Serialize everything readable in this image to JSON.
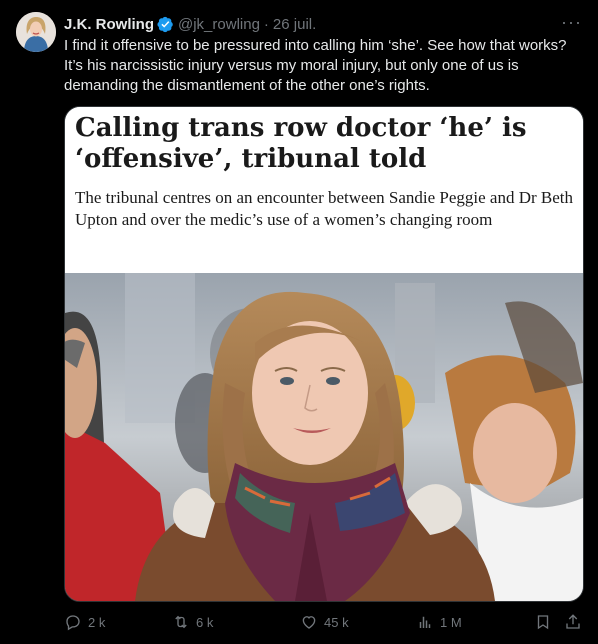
{
  "tweet": {
    "author_name": "J.K. Rowling",
    "handle": "@jk_rowling",
    "date": "26 juil.",
    "text": "I find it offensive to be pressured into calling him ‘she’. See how that works? It’s his narcissistic injury versus my moral injury, but only one of us is demanding the dismantlement of the other one’s rights."
  },
  "article": {
    "headline": "Calling trans row doctor ‘he’ is ‘offensive’, tribunal told",
    "standfirst": "The tribunal centres on an encounter between Sandie Peggie and Dr Beth Upton and over the medic’s use of a women’s changing room"
  },
  "actions": {
    "replies": "2 k",
    "reposts": "6 k",
    "likes": "45 k",
    "views": "1 M"
  },
  "colors": {
    "background": "#000000",
    "text": "#e7e9ea",
    "muted": "#71767b",
    "verified": "#1d9bf0"
  },
  "icons": [
    "verified-badge-icon",
    "more-icon",
    "reply-icon",
    "repost-icon",
    "like-icon",
    "views-icon",
    "bookmark-icon",
    "share-icon"
  ]
}
